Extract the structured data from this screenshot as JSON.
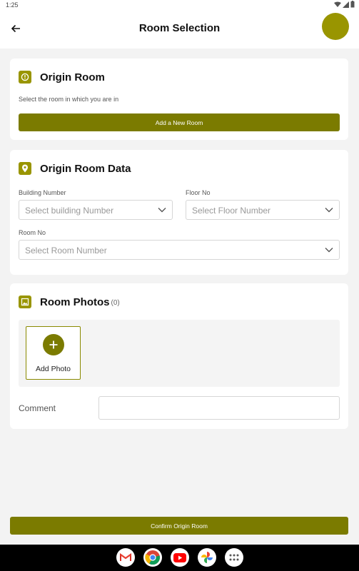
{
  "status_bar": {
    "time": "1:25"
  },
  "app_bar": {
    "title": "Room Selection"
  },
  "origin_room": {
    "title": "Origin Room",
    "subtitle": "Select the room in which you are in",
    "add_button": "Add a New Room"
  },
  "origin_room_data": {
    "title": "Origin Room Data",
    "building": {
      "label": "Building Number",
      "placeholder": "Select building Number"
    },
    "floor": {
      "label": "Floor No",
      "placeholder": "Select Floor Number"
    },
    "room": {
      "label": "Room No",
      "placeholder": "Select Room Number"
    }
  },
  "room_photos": {
    "title": "Room Photos",
    "count": "(0)",
    "add_photo_label": "Add Photo",
    "comment_label": "Comment",
    "comment_value": ""
  },
  "confirm_button": "Confirm Origin Room",
  "dock": {
    "apps": [
      "gmail-icon",
      "chrome-icon",
      "youtube-icon",
      "photos-icon",
      "app-drawer-icon"
    ]
  },
  "colors": {
    "accent": "#999500",
    "button": "#7b7b00",
    "background": "#f3f3f3"
  }
}
